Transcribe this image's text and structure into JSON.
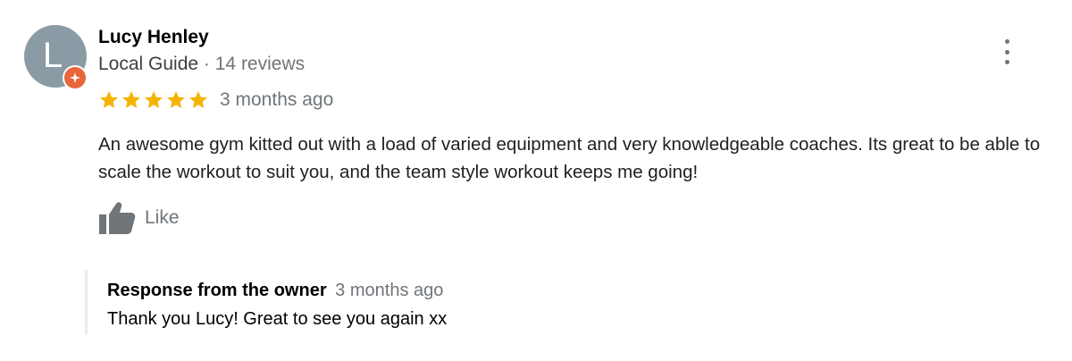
{
  "reviewer": {
    "name": "Lucy Henley",
    "initial": "L",
    "badge": "Local Guide",
    "separator": " · ",
    "review_count": "14 reviews",
    "avatar_color": "#8a9ba6",
    "badge_color": "#e8653a"
  },
  "rating": {
    "stars": 5,
    "max_stars": 5,
    "star_color": "#f4b400",
    "time_ago": "3 months ago"
  },
  "review_text": "An awesome gym kitted out with a load of varied equipment and very knowledgeable coaches. Its great to be able to scale the workout to suit you, and the team style workout keeps me going!",
  "actions": {
    "like_label": "Like",
    "like_icon": "thumbs-up-icon",
    "more_icon": "more-vert-icon"
  },
  "owner_response": {
    "title": "Response from the owner",
    "time_ago": "3 months ago",
    "text": "Thank you Lucy! Great to see you again xx"
  }
}
